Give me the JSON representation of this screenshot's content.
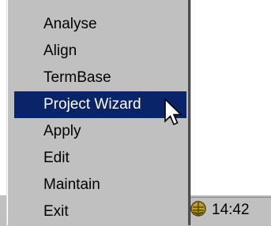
{
  "menu": {
    "items": [
      {
        "label": "Analyse"
      },
      {
        "label": "Align"
      },
      {
        "label": "TermBase"
      },
      {
        "label": "Project Wizard",
        "selected": true
      },
      {
        "label": "Apply"
      },
      {
        "label": "Edit"
      },
      {
        "label": "Maintain"
      },
      {
        "label": "Exit"
      }
    ]
  },
  "tray": {
    "time": "14:42",
    "icon": "app-tray-icon"
  },
  "colors": {
    "menu_bg": "#c0c0c0",
    "highlight": "#0a246a",
    "highlight_text": "#ffffff"
  },
  "cursor": "arrow-cursor-icon"
}
